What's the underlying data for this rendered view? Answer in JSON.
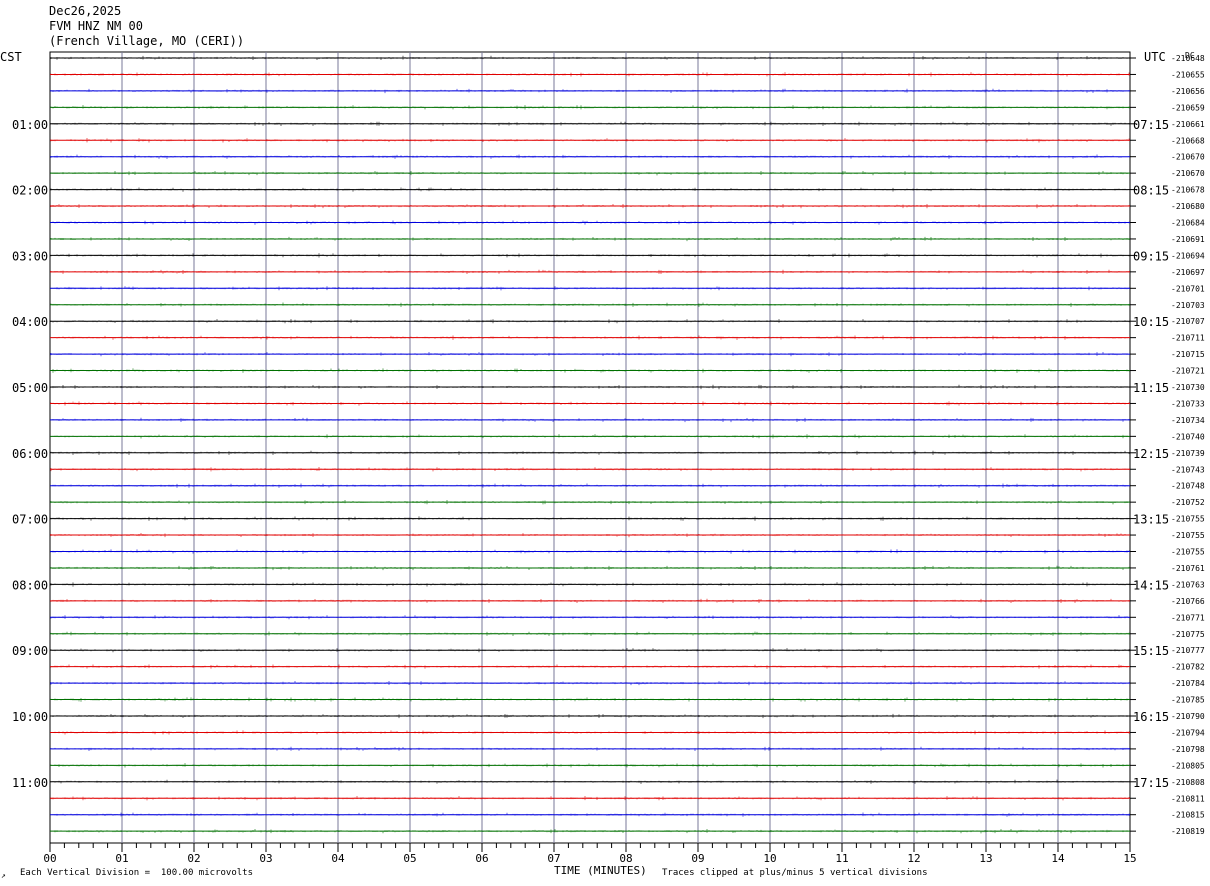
{
  "header": {
    "date": "Dec26,2025",
    "station": "FVM HNZ NM 00",
    "location": "(French Village, MO (CERI))"
  },
  "left_tz": "CST",
  "right_tz": "UTC",
  "dc_label": "DC",
  "footer": {
    "scale_note": "Each Vertical Division =  100.00 microvolts",
    "clip_note": "Traces clipped at plus/minus 5 vertical divisions",
    "corner_mark": "↗"
  },
  "chart_data": {
    "type": "line",
    "title": "",
    "xlabel": "TIME (MINUTES)",
    "x_ticks": [
      "00",
      "01",
      "02",
      "03",
      "04",
      "05",
      "06",
      "07",
      "08",
      "09",
      "10",
      "11",
      "12",
      "13",
      "14",
      "15"
    ],
    "xlim": [
      0,
      15
    ],
    "grid": true,
    "row_colors": [
      "#000000",
      "#e00000",
      "#0000dd",
      "#007000"
    ],
    "left_hour_labels": [
      "01:00",
      "02:00",
      "03:00",
      "04:00",
      "05:00",
      "06:00",
      "07:00",
      "08:00",
      "09:00",
      "10:00",
      "11:00"
    ],
    "right_hour_labels": [
      "07:15",
      "08:15",
      "09:15",
      "10:15",
      "11:15",
      "12:15",
      "13:15",
      "14:15",
      "15:15",
      "16:15",
      "17:15"
    ],
    "dc_offsets": [
      210648,
      210655,
      210656,
      210659,
      210661,
      210668,
      210670,
      210670,
      210678,
      210680,
      210684,
      210691,
      210694,
      210697,
      210701,
      210703,
      210707,
      210711,
      210715,
      210721,
      210730,
      210733,
      210734,
      210740,
      210739,
      210743,
      210748,
      210752,
      210755,
      210755,
      210755,
      210761,
      210763,
      210766,
      210771,
      210775,
      210777,
      210782,
      210784,
      210785,
      210790,
      210794,
      210798,
      210805,
      210808,
      210811,
      210815,
      210819
    ]
  }
}
